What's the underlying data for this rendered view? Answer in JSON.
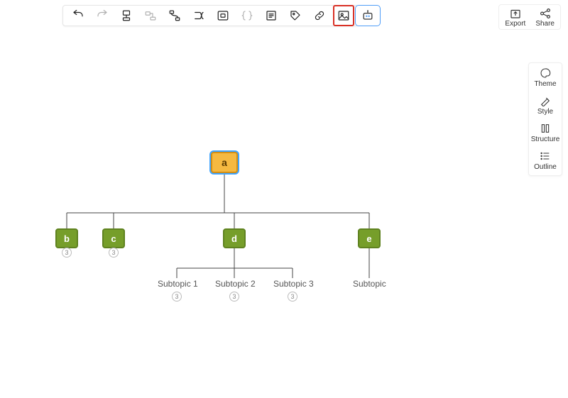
{
  "toolbar": {
    "items": [
      "undo",
      "redo",
      "topic",
      "subtopic",
      "relationship",
      "summary",
      "boundary",
      "braces",
      "note",
      "label",
      "link",
      "image"
    ],
    "highlighted": "image",
    "ai_label": "ai-assistant"
  },
  "top_right": {
    "export": "Export",
    "share": "Share"
  },
  "side_panel": {
    "theme": "Theme",
    "style": "Style",
    "structure": "Structure",
    "outline": "Outline"
  },
  "mindmap": {
    "root": "a",
    "children": [
      {
        "label": "b",
        "badge": "3"
      },
      {
        "label": "c",
        "badge": "3"
      },
      {
        "label": "d",
        "children": [
          {
            "label": "Subtopic 1",
            "badge": "3"
          },
          {
            "label": "Subtopic 2",
            "badge": "3"
          },
          {
            "label": "Subtopic 3",
            "badge": "3"
          }
        ]
      },
      {
        "label": "e",
        "children": [
          {
            "label": "Subtopic"
          }
        ]
      }
    ]
  }
}
